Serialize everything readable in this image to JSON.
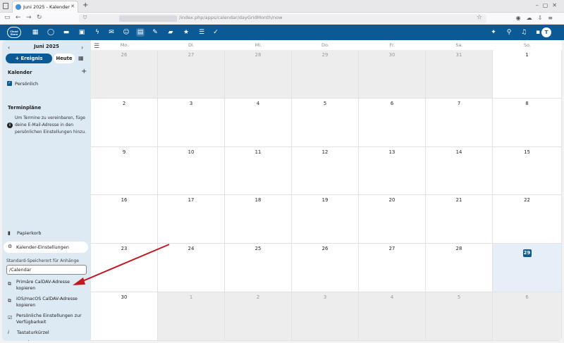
{
  "browser": {
    "tab_title": "Juni 2025 - Kalender - Da",
    "tab_close": "✕",
    "new_tab": "+",
    "url_path": "/index.php/apps/calendar/dayGridMonth/now"
  },
  "header": {
    "logo_text": "Cloud Store",
    "avatar": "T"
  },
  "sidebar": {
    "month_label": "Juni 2025",
    "prev": "‹",
    "next": "›",
    "new_event": "+ Ereignis",
    "today": "Heute",
    "calendars_heading": "Kalender",
    "calendar_add": "+",
    "calendar_name": "Persönlich",
    "schedule_heading": "Terminpläne",
    "schedule_text": "Um Termine zu vereinbaren, füge deine E-Mail-Adresse in den persönlichen Einstellungen hinzu.",
    "trash": "Papierkorb",
    "settings": "Kalender-Einstellungen",
    "attach_label": "Standard-Speicherort für Anhänge",
    "attach_value": "/Calendar",
    "primary_caldav": "Primäre CalDAV-Adresse kopieren",
    "ios_caldav": "iOS/macOS CalDAV-Adresse kopieren",
    "availability": "Persönliche Einstellungen zur Verfügbarkeit",
    "shortcuts": "Tastaturkürzel anzeigen"
  },
  "calendar": {
    "weekdays": [
      "Mo.",
      "Di.",
      "Mi.",
      "Do.",
      "Fr.",
      "Sa.",
      "So."
    ],
    "weeks": [
      [
        {
          "n": "26",
          "o": true
        },
        {
          "n": "27",
          "o": true
        },
        {
          "n": "28",
          "o": true
        },
        {
          "n": "29",
          "o": true
        },
        {
          "n": "30",
          "o": true
        },
        {
          "n": "31",
          "o": true
        },
        {
          "n": "1",
          "o": false
        }
      ],
      [
        {
          "n": "2",
          "o": false
        },
        {
          "n": "3",
          "o": false
        },
        {
          "n": "4",
          "o": false
        },
        {
          "n": "5",
          "o": false
        },
        {
          "n": "6",
          "o": false
        },
        {
          "n": "7",
          "o": false
        },
        {
          "n": "8",
          "o": false
        }
      ],
      [
        {
          "n": "9",
          "o": false
        },
        {
          "n": "10",
          "o": false
        },
        {
          "n": "11",
          "o": false
        },
        {
          "n": "12",
          "o": false
        },
        {
          "n": "13",
          "o": false
        },
        {
          "n": "14",
          "o": false
        },
        {
          "n": "15",
          "o": false
        }
      ],
      [
        {
          "n": "16",
          "o": false
        },
        {
          "n": "17",
          "o": false
        },
        {
          "n": "18",
          "o": false
        },
        {
          "n": "19",
          "o": false
        },
        {
          "n": "20",
          "o": false
        },
        {
          "n": "21",
          "o": false
        },
        {
          "n": "22",
          "o": false
        }
      ],
      [
        {
          "n": "23",
          "o": false
        },
        {
          "n": "24",
          "o": false
        },
        {
          "n": "25",
          "o": false
        },
        {
          "n": "26",
          "o": false
        },
        {
          "n": "27",
          "o": false
        },
        {
          "n": "28",
          "o": false
        },
        {
          "n": "29",
          "o": false,
          "today": true
        }
      ],
      [
        {
          "n": "30",
          "o": false
        },
        {
          "n": "1",
          "o": true
        },
        {
          "n": "2",
          "o": true
        },
        {
          "n": "3",
          "o": true
        },
        {
          "n": "4",
          "o": true
        },
        {
          "n": "5",
          "o": true
        },
        {
          "n": "6",
          "o": true
        }
      ]
    ]
  },
  "colors": {
    "brand": "#0b5a96",
    "annotation": "#c0181f"
  }
}
